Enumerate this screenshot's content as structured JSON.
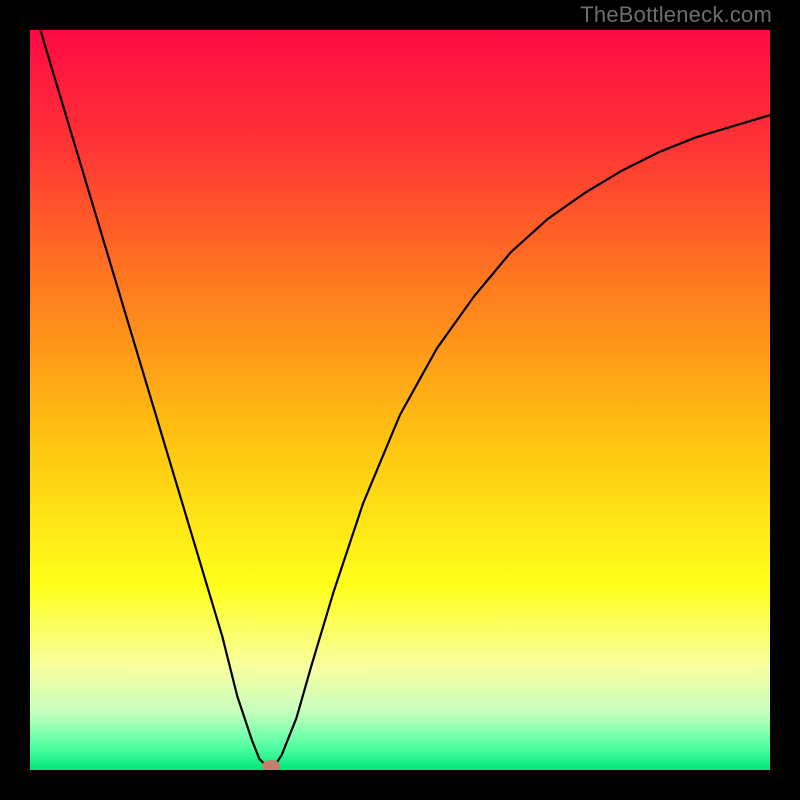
{
  "watermark": "TheBottleneck.com",
  "chart_data": {
    "type": "line",
    "title": "",
    "xlabel": "",
    "ylabel": "",
    "xlim": [
      0,
      100
    ],
    "ylim": [
      0,
      100
    ],
    "grid": false,
    "legend": false,
    "background_gradient_stops": [
      {
        "pos": 0.0,
        "color": "#ff0a44"
      },
      {
        "pos": 0.15,
        "color": "#ff3235"
      },
      {
        "pos": 0.35,
        "color": "#ff7c1f"
      },
      {
        "pos": 0.55,
        "color": "#ffc211"
      },
      {
        "pos": 0.75,
        "color": "#ffff1a"
      },
      {
        "pos": 0.86,
        "color": "#f8ffa0"
      },
      {
        "pos": 0.92,
        "color": "#c8ffbe"
      },
      {
        "pos": 0.97,
        "color": "#4fffa2"
      },
      {
        "pos": 1.0,
        "color": "#00e77a"
      }
    ],
    "series": [
      {
        "name": "bottleneck-curve",
        "color": "#000000",
        "x": [
          0,
          2,
          5,
          8,
          11,
          14,
          17,
          20,
          23,
          26,
          28,
          30,
          31,
          32,
          33,
          34,
          36,
          38,
          41,
          45,
          50,
          55,
          60,
          65,
          70,
          75,
          80,
          85,
          90,
          95,
          100
        ],
        "y": [
          105,
          98,
          88,
          78,
          68,
          58,
          48,
          38,
          28,
          18,
          10,
          4,
          1.5,
          0.5,
          0.5,
          2,
          7,
          14,
          24,
          36,
          48,
          57,
          64,
          70,
          74.5,
          78,
          81,
          83.5,
          85.5,
          87,
          88.5
        ]
      }
    ],
    "marker": {
      "name": "minimum-point",
      "x": 32.5,
      "y": 0.5,
      "color": "#c87d6e"
    }
  }
}
